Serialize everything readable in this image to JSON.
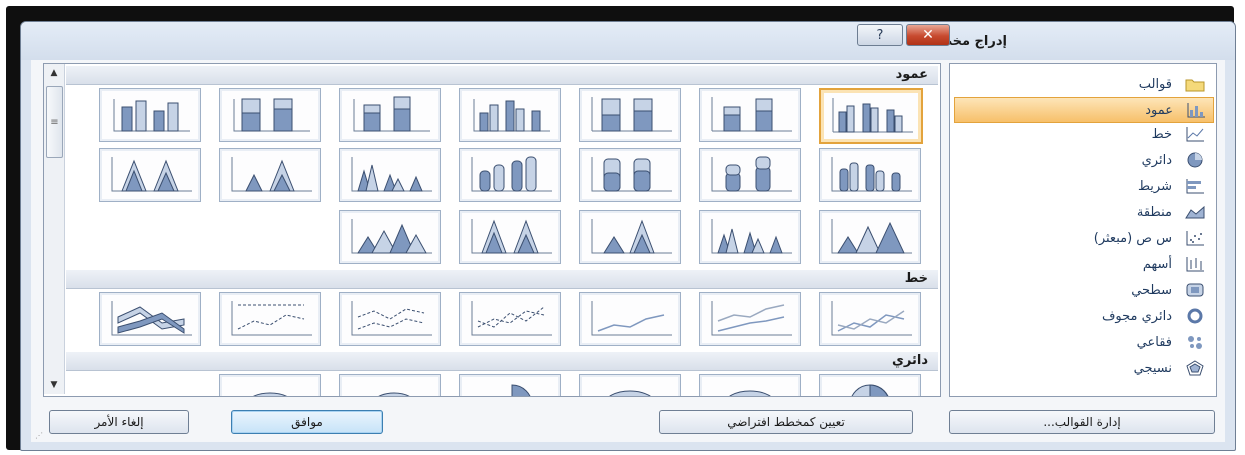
{
  "dialog": {
    "title": "إدراج مخطط",
    "help_icon": "?",
    "close_icon": "✕"
  },
  "categories": [
    {
      "label": "قوالب",
      "icon": "folder-icon"
    },
    {
      "label": "عمود",
      "icon": "column-chart-icon",
      "selected": true
    },
    {
      "label": "خط",
      "icon": "line-chart-icon"
    },
    {
      "label": "دائري",
      "icon": "pie-chart-icon"
    },
    {
      "label": "شريط",
      "icon": "bar-chart-icon"
    },
    {
      "label": "منطقة",
      "icon": "area-chart-icon"
    },
    {
      "label": "س ص (مبعثر)",
      "icon": "scatter-chart-icon"
    },
    {
      "label": "أسهم",
      "icon": "stock-chart-icon"
    },
    {
      "label": "سطحي",
      "icon": "surface-chart-icon"
    },
    {
      "label": "دائري مجوف",
      "icon": "doughnut-chart-icon"
    },
    {
      "label": "فقاعي",
      "icon": "bubble-chart-icon"
    },
    {
      "label": "نسيجي",
      "icon": "radar-chart-icon"
    }
  ],
  "gallery": {
    "sections": [
      {
        "label": "عمود"
      },
      {
        "label": "خط"
      },
      {
        "label": "دائري"
      }
    ]
  },
  "buttons": {
    "manage_templates": "إدارة القوالب...",
    "set_default": "تعيين كمخطط افتراضي",
    "ok": "موافق",
    "cancel": "إلغاء الأمر"
  },
  "colors": {
    "selection": "#f7c06a",
    "accent": "#3c7fb1"
  }
}
